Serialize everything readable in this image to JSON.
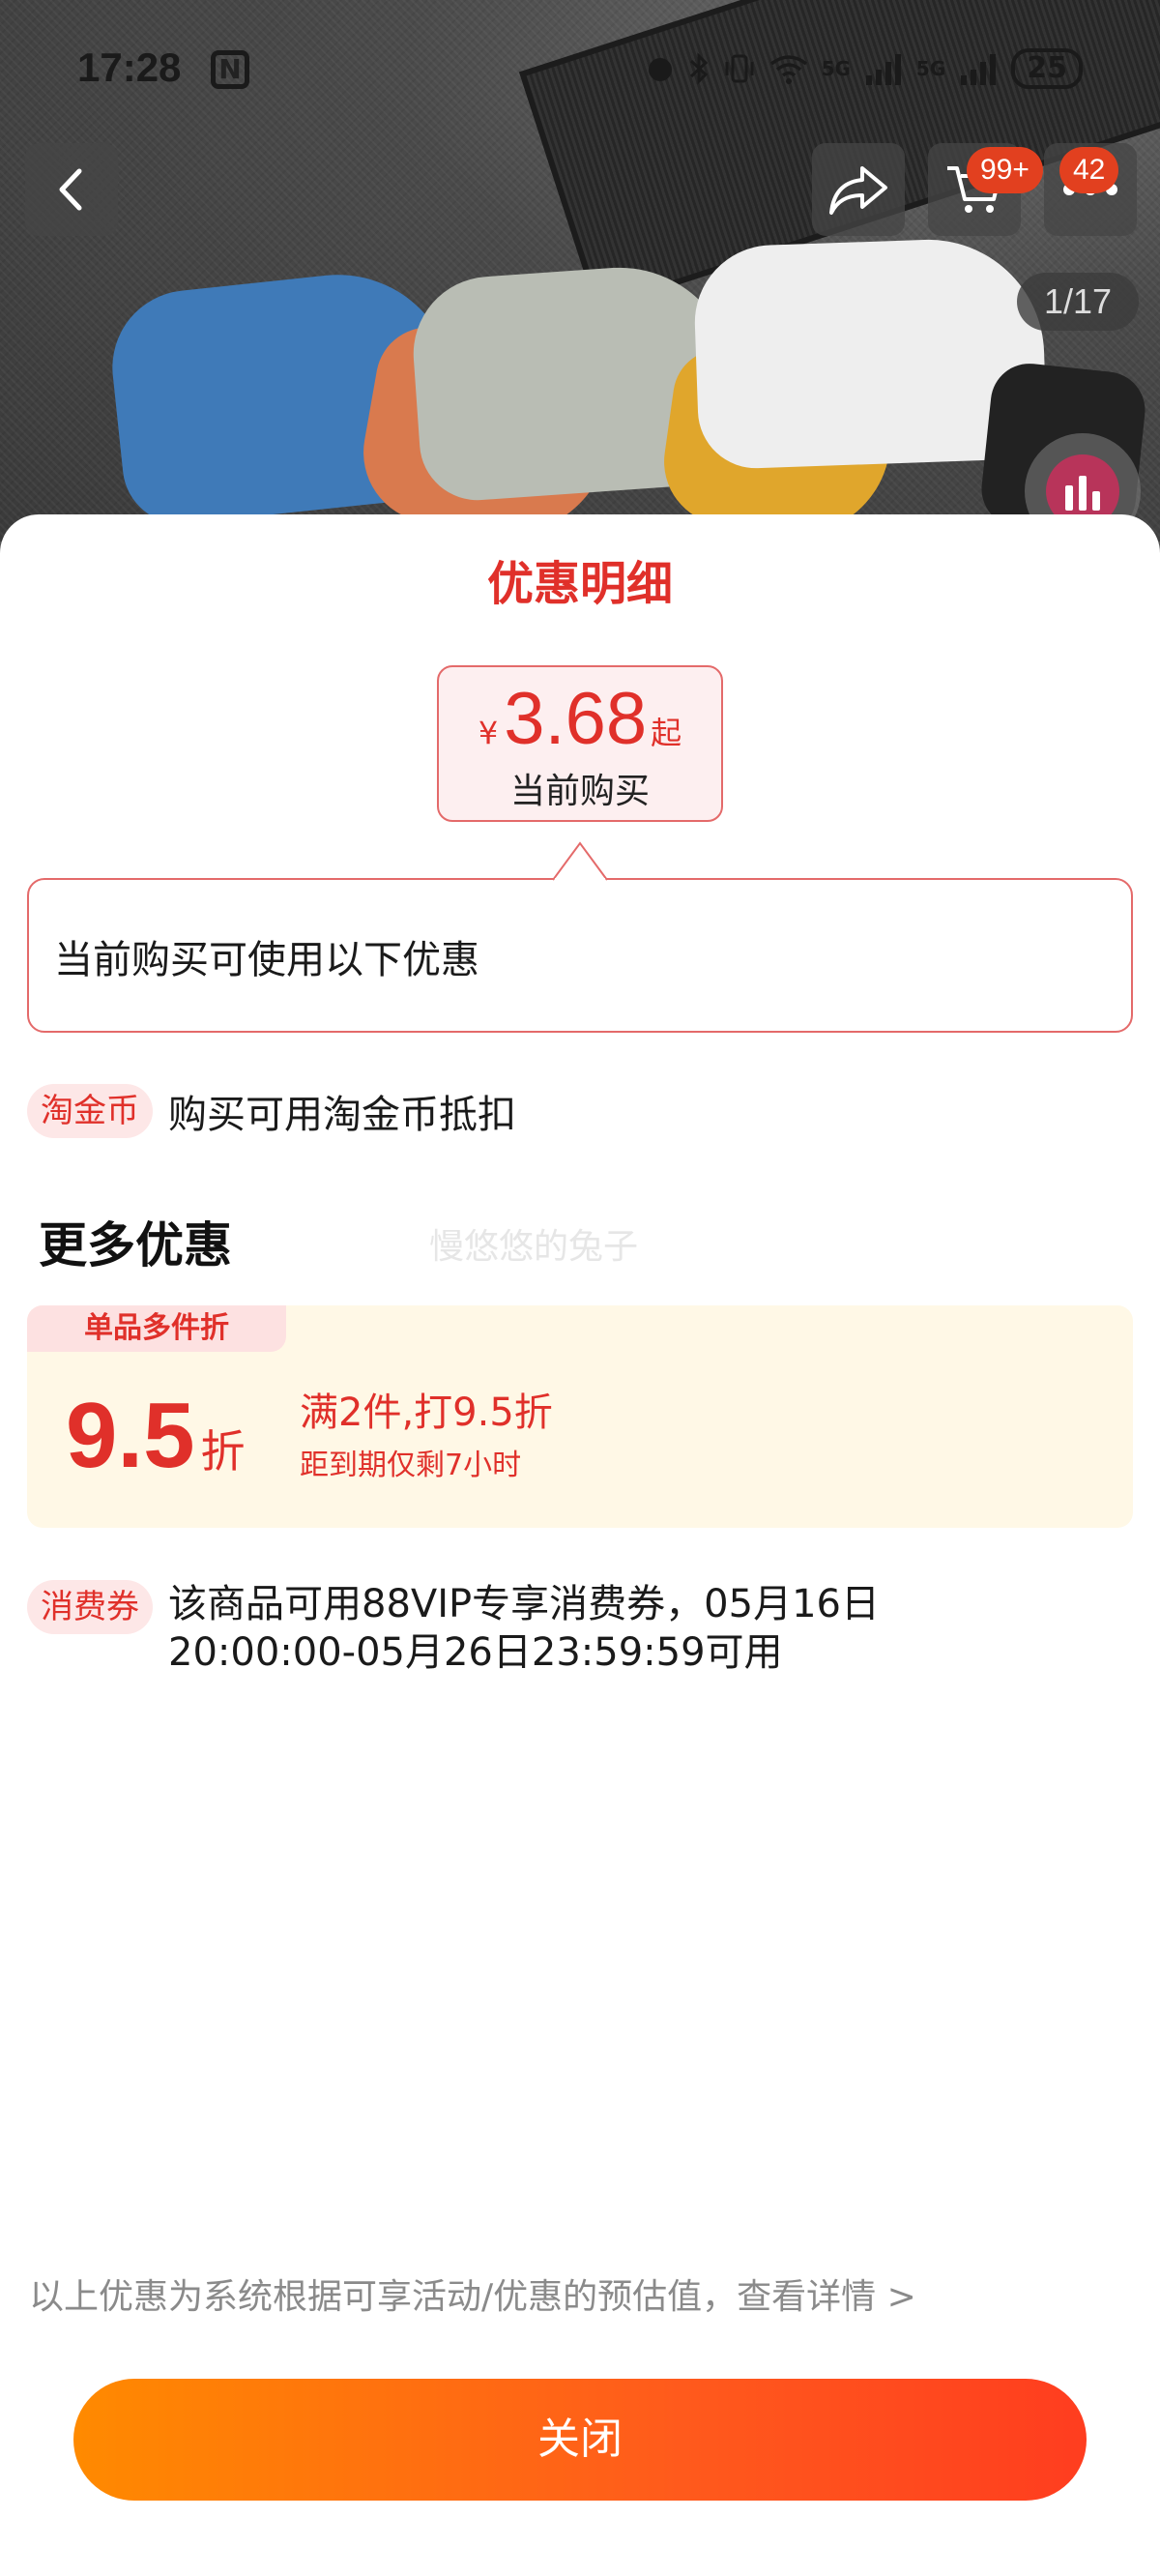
{
  "status_bar": {
    "time": "17:28",
    "nfc_label": "N",
    "network_5g_a": "5G",
    "network_5g_b": "5G",
    "battery": "25"
  },
  "nav": {
    "cart_badge": "99+",
    "message_badge": "42",
    "image_page": "1/17"
  },
  "sheet": {
    "title": "优惠明细",
    "price": {
      "currency": "¥",
      "amount": "3.68",
      "suffix": "起",
      "caption": "当前购买"
    },
    "info_text": "当前购买可使用以下优惠",
    "gold_coin": {
      "tag": "淘金币",
      "description": "购买可用淘金币抵扣"
    },
    "more_title": "更多优惠",
    "watermark": "慢悠悠的兔子",
    "multi_discount": {
      "tag": "单品多件折",
      "value": "9.5",
      "unit": "折",
      "rule": "满2件,打9.5折",
      "expire": "距到期仅剩7小时"
    },
    "coupon": {
      "tag": "消费券",
      "description_line1": "该商品可用88VIP专享消费券，05月16日",
      "description_line2": "20:00:00-05月26日23:59:59可用"
    },
    "footnote": "以上优惠为系统根据可享活动/优惠的预估值，查看详情 >",
    "close_label": "关闭"
  },
  "colors": {
    "accent_red": "#e0302a",
    "button_gradient_start": "#ff8a00",
    "button_gradient_end": "#ff3d1f",
    "discount_card_bg": "#fff8e6"
  },
  "icons": [
    "back-arrow-icon",
    "share-icon",
    "cart-icon",
    "more-icon",
    "nfc-icon",
    "wifi-icon",
    "signal-icon",
    "battery-icon",
    "chart-bars-icon"
  ]
}
